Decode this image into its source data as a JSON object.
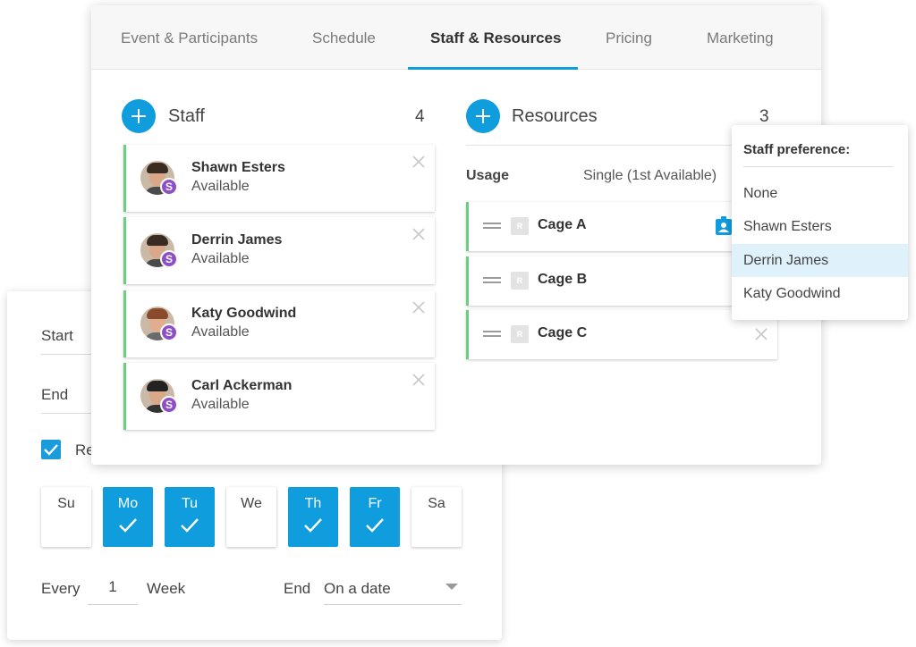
{
  "schedule": {
    "start_label": "Start",
    "end_label": "End",
    "recurring_label": "Re",
    "days": [
      {
        "label": "Su",
        "checked": false
      },
      {
        "label": "Mo",
        "checked": true
      },
      {
        "label": "Tu",
        "checked": true
      },
      {
        "label": "We",
        "checked": false
      },
      {
        "label": "Th",
        "checked": true
      },
      {
        "label": "Fr",
        "checked": true
      },
      {
        "label": "Sa",
        "checked": false
      }
    ],
    "every_label": "Every",
    "every_value": "1",
    "unit_label": "Week",
    "end_type_label": "End",
    "end_type_value": "On a date"
  },
  "tabs": [
    {
      "label": "Event & Participants",
      "active": false
    },
    {
      "label": "Schedule",
      "active": false
    },
    {
      "label": "Staff & Resources",
      "active": true
    },
    {
      "label": "Pricing",
      "active": false
    },
    {
      "label": "Marketing",
      "active": false
    }
  ],
  "staff": {
    "title": "Staff",
    "count": "4",
    "badge_letter": "S",
    "members": [
      {
        "name": "Shawn Esters",
        "status": "Available"
      },
      {
        "name": "Derrin James",
        "status": "Available"
      },
      {
        "name": "Katy Goodwind",
        "status": "Available"
      },
      {
        "name": "Carl Ackerman",
        "status": "Available"
      }
    ]
  },
  "resources": {
    "title": "Resources",
    "count": "3",
    "usage_label": "Usage",
    "usage_value": "Single (1st Available)",
    "icon_letter": "R",
    "items": [
      {
        "name": "Cage A"
      },
      {
        "name": "Cage B"
      },
      {
        "name": "Cage C"
      }
    ]
  },
  "staff_preference": {
    "title": "Staff preference:",
    "options": [
      {
        "label": "None",
        "selected": false
      },
      {
        "label": "Shawn Esters",
        "selected": false
      },
      {
        "label": "Derrin James",
        "selected": true
      },
      {
        "label": "Katy Goodwind",
        "selected": false
      }
    ]
  },
  "colors": {
    "accent": "#0f9ddd",
    "available": "#6bcf7f",
    "staff_badge": "#8e4ec6",
    "selected_option": "#dff1fb"
  }
}
